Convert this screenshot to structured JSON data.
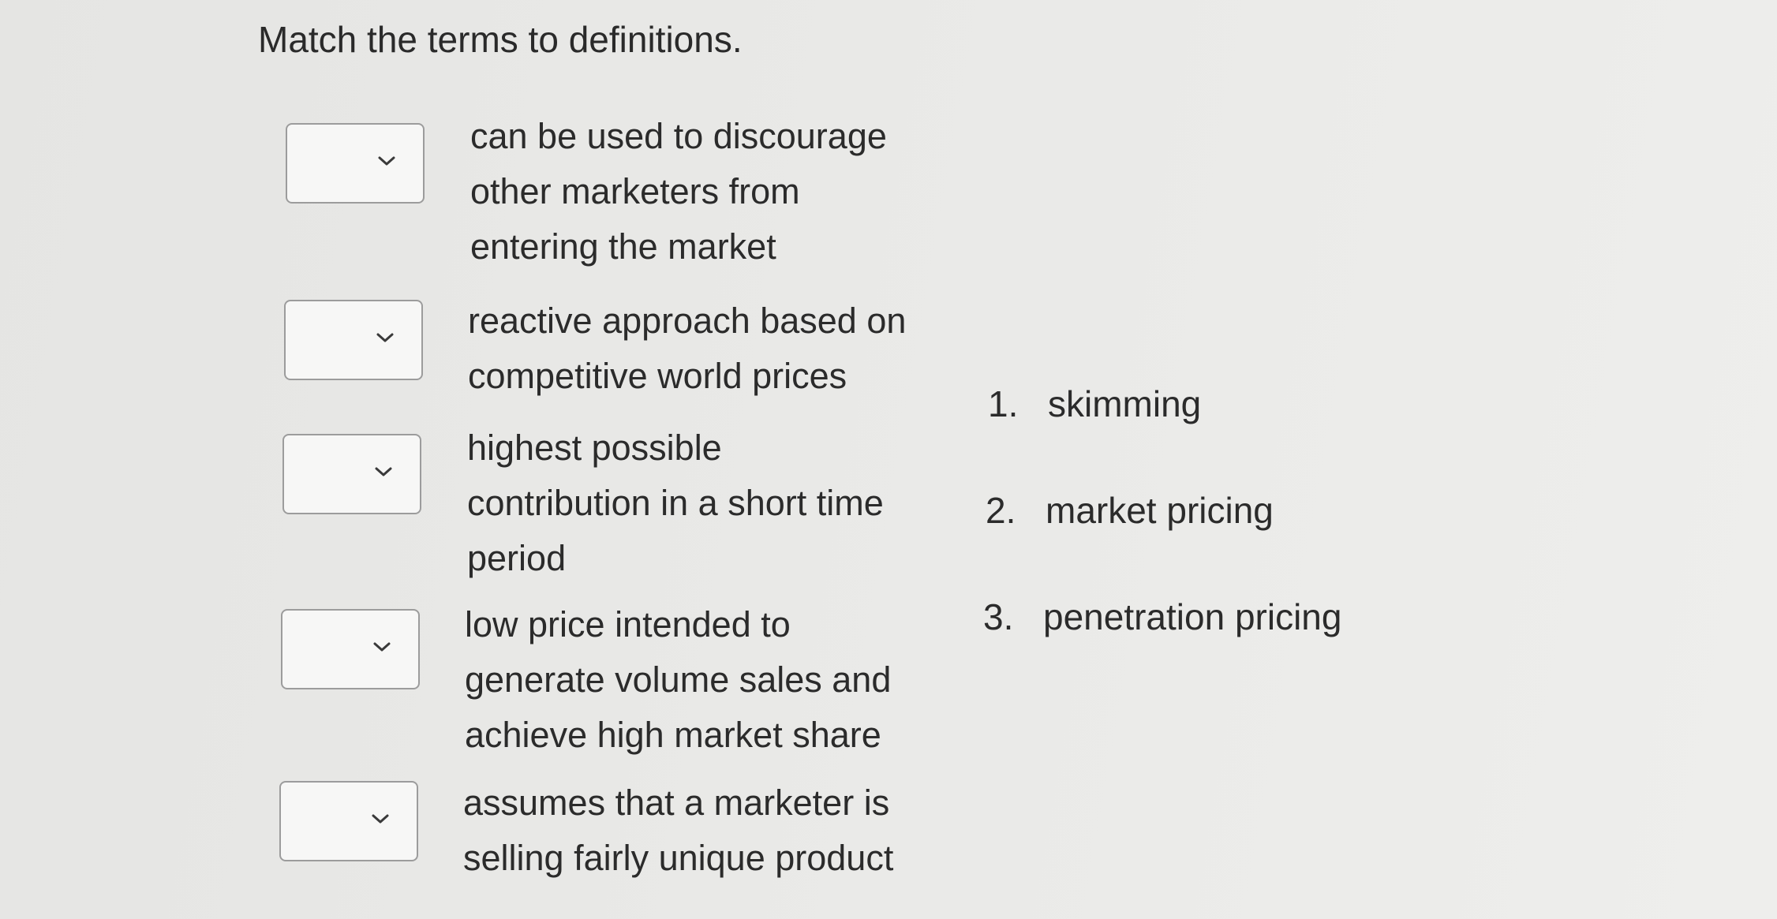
{
  "title": "Match the terms to definitions.",
  "definitions": [
    {
      "lines": [
        "can be used to discourage",
        "other marketers from",
        "entering the market"
      ],
      "selected": ""
    },
    {
      "lines": [
        "reactive approach based on",
        "competitive world prices"
      ],
      "selected": ""
    },
    {
      "lines": [
        "highest possible",
        "contribution in a short time",
        "period"
      ],
      "selected": ""
    },
    {
      "lines": [
        "low price intended to",
        "generate volume sales and",
        "achieve high market share"
      ],
      "selected": ""
    },
    {
      "lines": [
        "assumes that a marketer is",
        "selling fairly unique product"
      ],
      "selected": ""
    }
  ],
  "terms": [
    {
      "number": "1.",
      "label": "skimming"
    },
    {
      "number": "2.",
      "label": "market pricing"
    },
    {
      "number": "3.",
      "label": "penetration pricing"
    }
  ],
  "icons": {
    "dropdown": "chevron-down-icon"
  },
  "colors": {
    "background": "#e9e9e7",
    "text": "#2b2b2b",
    "dropdown_border": "#9c9c9c"
  }
}
